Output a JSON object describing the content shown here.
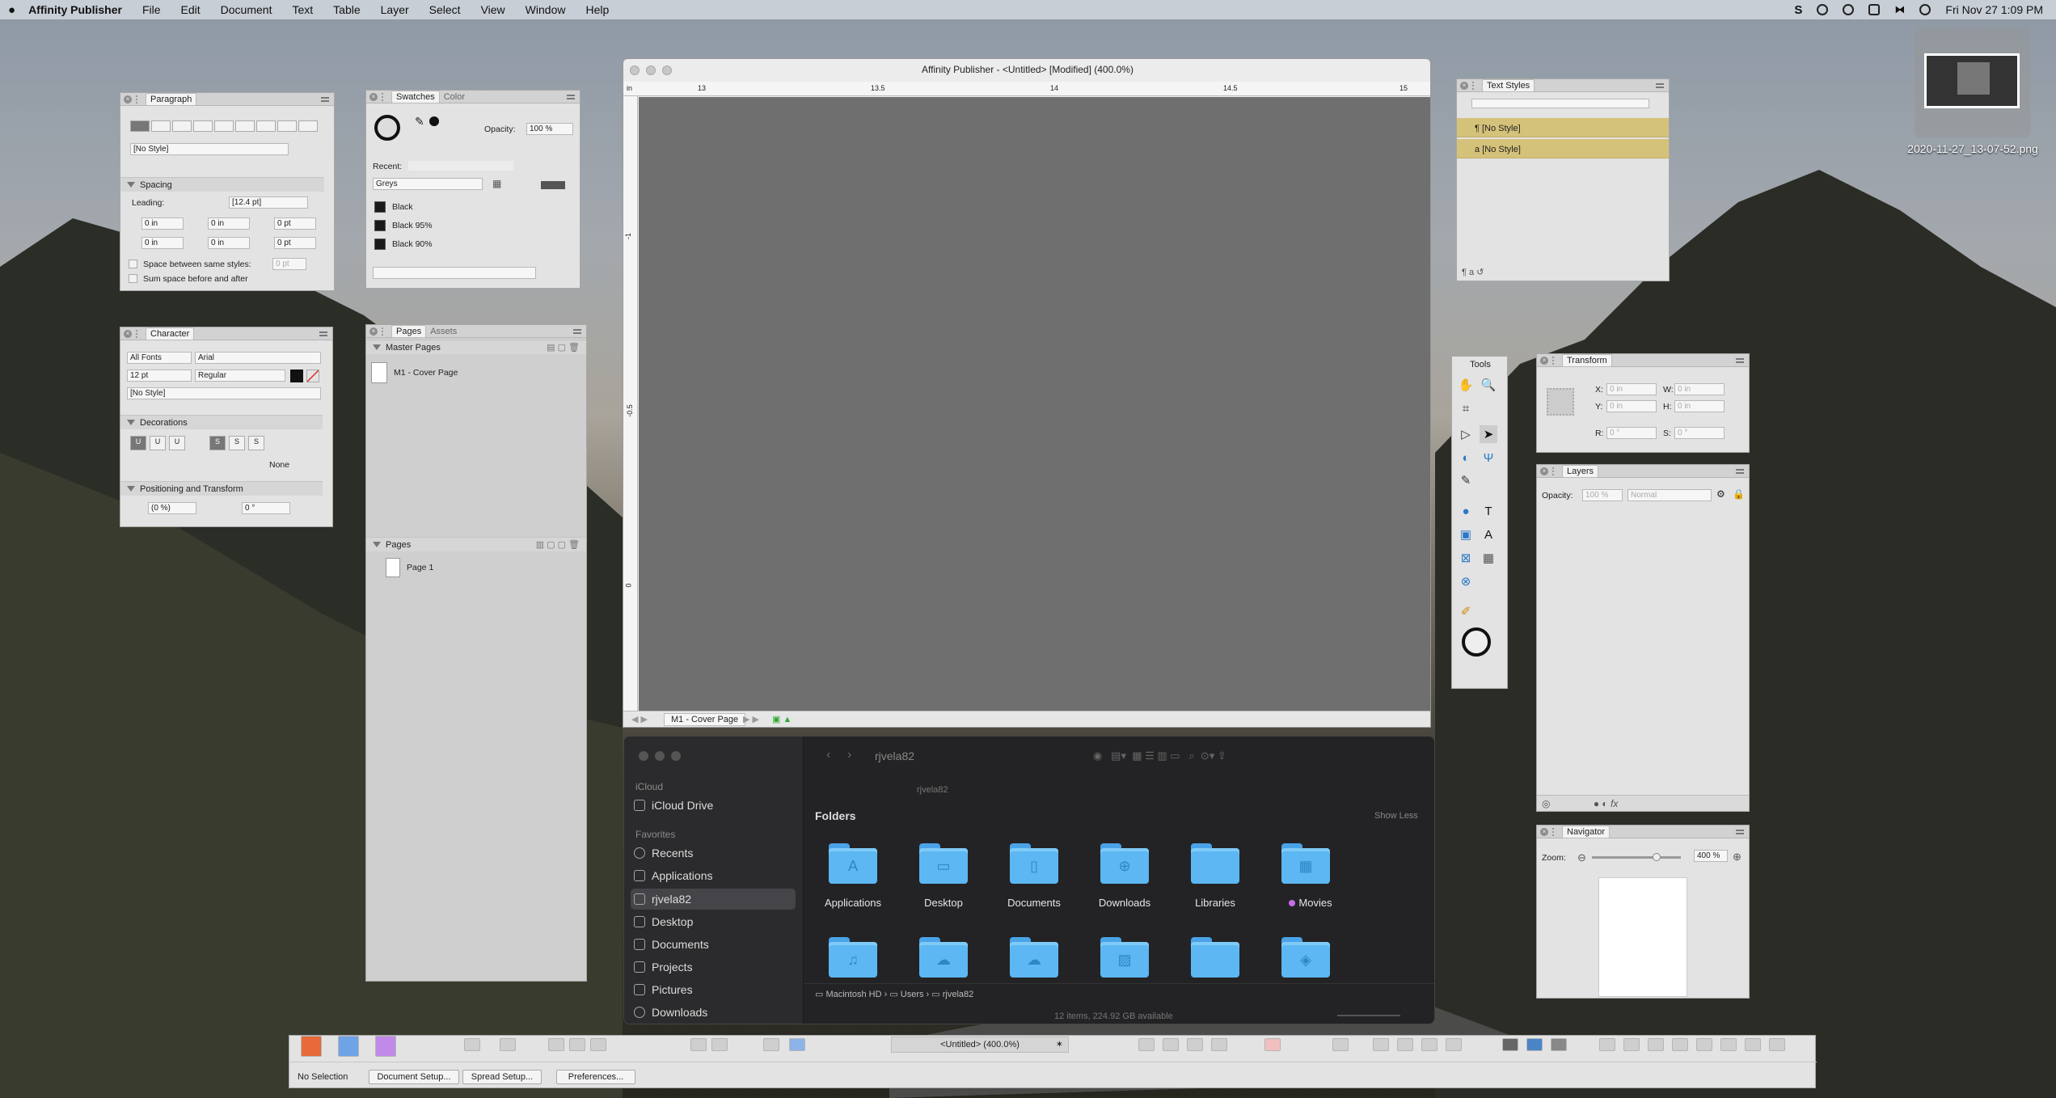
{
  "menubar": {
    "app": "Affinity Publisher",
    "items": [
      "File",
      "Edit",
      "Document",
      "Text",
      "Table",
      "Layer",
      "Select",
      "View",
      "Window",
      "Help"
    ],
    "clock": "Fri Nov 27  1:09 PM"
  },
  "desktop": {
    "file_name": "2020-11-27_13-07-52.png"
  },
  "paragraph": {
    "tab": "Paragraph",
    "style": "[No Style]",
    "spacing_section": "Spacing",
    "leading_label": "Leading:",
    "leading_value": "[12.4 pt]",
    "left_indent": "0 in",
    "first_indent": "0 in",
    "space_before": "0 pt",
    "right_indent": "0 in",
    "last_indent": "0 in",
    "space_after": "0 pt",
    "between_label": "Space between same styles:",
    "between_value": "0 pt",
    "sum_label": "Sum space before and after"
  },
  "swatches": {
    "tab_active": "Swatches",
    "tab_other": "Color",
    "opacity_label": "Opacity:",
    "opacity_value": "100 %",
    "recent_label": "Recent:",
    "palette": "Greys",
    "items": [
      "Black",
      "Black 95%",
      "Black 90%"
    ]
  },
  "character": {
    "tab": "Character",
    "font_collection": "All Fonts",
    "font": "Arial",
    "size": "12 pt",
    "weight": "Regular",
    "style": "[No Style]",
    "decorations_section": "Decorations",
    "decorations_none": "None",
    "positioning_section": "Positioning and Transform",
    "baseline": "(0 %)",
    "skew": "0 °"
  },
  "pages": {
    "tab_active": "Pages",
    "tab_other": "Assets",
    "master_section": "Master Pages",
    "master_item": "M1 - Cover Page",
    "pages_section": "Pages",
    "page_item": "Page 1"
  },
  "document": {
    "title": "Affinity Publisher - <Untitled> [Modified] (400.0%)",
    "ruler_unit": "in",
    "ruler_h": [
      "13",
      "13.5",
      "14",
      "14.5",
      "15"
    ],
    "ruler_v": [
      "-1",
      "-0.5",
      "0"
    ],
    "status_page": "M1 - Cover Page"
  },
  "text_styles": {
    "tab": "Text Styles",
    "items": [
      "[No Style]",
      "[No Style]"
    ]
  },
  "tools": {
    "title": "Tools"
  },
  "transform": {
    "tab": "Transform",
    "x_label": "X:",
    "x_value": "0 in",
    "y_label": "Y:",
    "y_value": "0 in",
    "w_label": "W:",
    "w_value": "0 in",
    "h_label": "H:",
    "h_value": "0 in",
    "r_label": "R:",
    "r_value": "0 °",
    "s_label": "S:",
    "s_value": "0 °"
  },
  "layers": {
    "tab": "Layers",
    "opacity_label": "Opacity:",
    "opacity_value": "100 %",
    "blend": "Normal"
  },
  "navigator": {
    "tab": "Navigator",
    "zoom_label": "Zoom:",
    "zoom_value": "400 %",
    "zoom_fraction": 0.8
  },
  "finder": {
    "title": "rjvela82",
    "path_title": "rjvela82",
    "sections": {
      "icloud": "iCloud",
      "favorites": "Favorites"
    },
    "sidebar": [
      "iCloud Drive",
      "Recents",
      "Applications",
      "rjvela82",
      "Desktop",
      "Documents",
      "Projects",
      "Pictures",
      "Downloads"
    ],
    "folders_header": "Folders",
    "show_less": "Show Less",
    "folders": [
      "Applications",
      "Desktop",
      "Documents",
      "Downloads",
      "Libraries",
      "Movies"
    ],
    "breadcrumb": [
      "Macintosh HD",
      "Users",
      "rjvela82"
    ],
    "status": "12 items, 224.92 GB available"
  },
  "bottombar": {
    "doc_tab": "<Untitled> (400.0%)",
    "selection": "No Selection",
    "doc_setup": "Document Setup...",
    "spread_setup": "Spread Setup...",
    "preferences": "Preferences..."
  }
}
